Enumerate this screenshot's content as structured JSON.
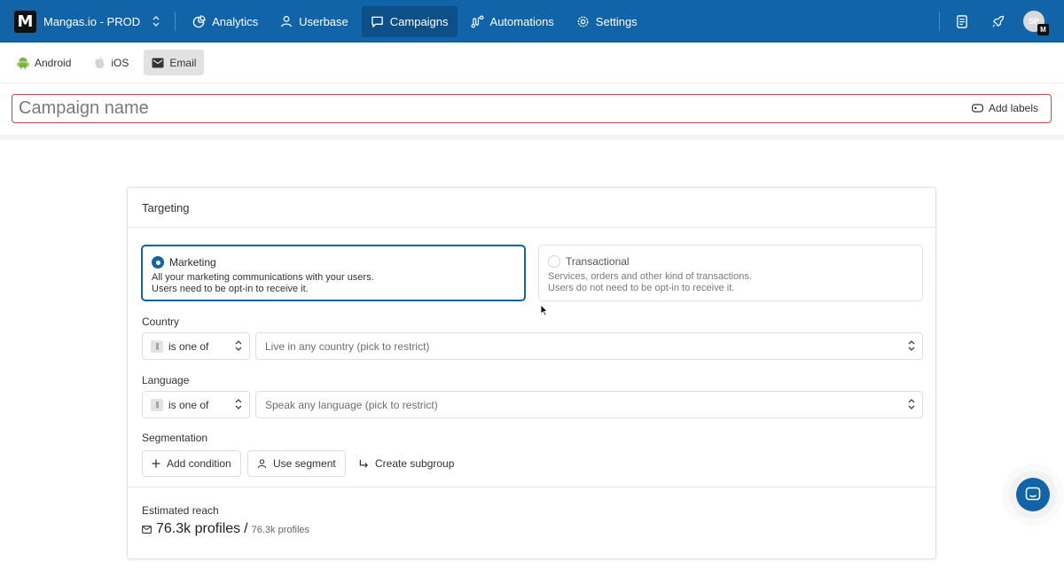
{
  "topnav": {
    "workspace": "Mangas.io - PROD",
    "logo_letter": "M",
    "items": [
      {
        "label": "Analytics",
        "icon": "chart-pie-icon"
      },
      {
        "label": "Userbase",
        "icon": "user-icon"
      },
      {
        "label": "Campaigns",
        "icon": "message-square-icon",
        "active": true
      },
      {
        "label": "Automations",
        "icon": "flow-icon"
      },
      {
        "label": "Settings",
        "icon": "gear-icon"
      }
    ],
    "avatar_initials": "SP",
    "avatar_badge": "M"
  },
  "subtabs": [
    {
      "label": "Android",
      "icon": "android-icon"
    },
    {
      "label": "iOS",
      "icon": "apple-icon"
    },
    {
      "label": "Email",
      "icon": "mail-icon",
      "active": true
    }
  ],
  "campaign": {
    "name_placeholder": "Campaign name",
    "add_labels": "Add labels"
  },
  "targeting": {
    "title": "Targeting",
    "options": [
      {
        "title": "Marketing",
        "line1": "All your marketing communications with your users.",
        "line2": "Users need to be opt-in to receive it.",
        "selected": true
      },
      {
        "title": "Transactional",
        "line1": "Services, orders and other kind of transactions.",
        "line2": "Users do not need to be opt-in to receive it.",
        "selected": false
      }
    ],
    "country": {
      "label": "Country",
      "operator": "is one of",
      "placeholder": "Live in any country (pick to restrict)"
    },
    "language": {
      "label": "Language",
      "operator": "is one of",
      "placeholder": "Speak any language (pick to restrict)"
    },
    "segmentation": {
      "label": "Segmentation",
      "add_condition": "Add condition",
      "use_segment": "Use segment",
      "create_subgroup": "Create subgroup"
    },
    "reach": {
      "label": "Estimated reach",
      "value": "76.3k profiles",
      "separator": "/",
      "total": "76.3k profiles"
    }
  },
  "colors": {
    "primary": "#1164a8",
    "active_nav": "#0d4f87",
    "error_border": "#c0484e"
  }
}
